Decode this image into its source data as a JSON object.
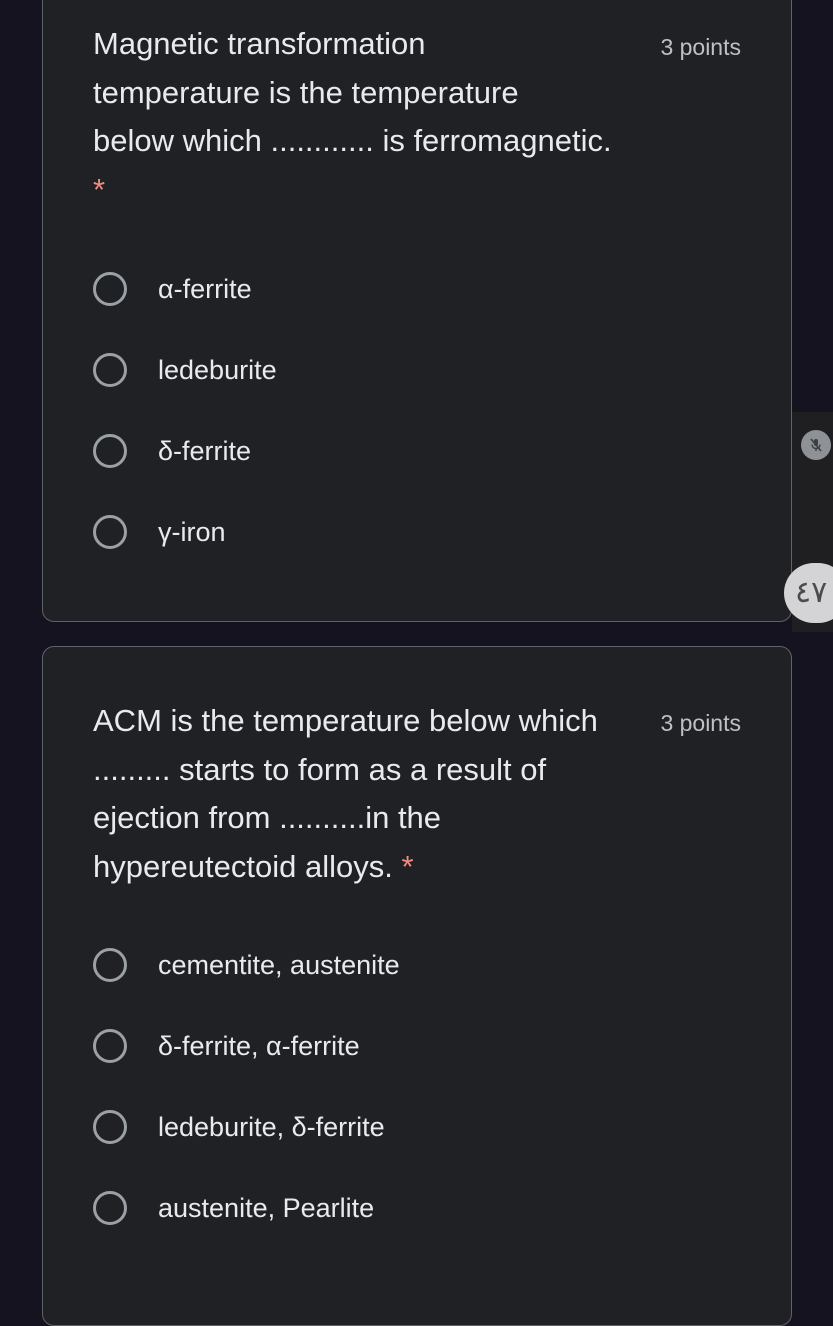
{
  "questions": [
    {
      "text_lines": [
        "Magnetic transformation",
        "temperature is the temperature",
        "below which ............ is ferromagnetic."
      ],
      "required_marker": "*",
      "points": "3 points",
      "options": [
        "α-ferrite",
        "ledeburite",
        "δ-ferrite",
        "γ-iron"
      ]
    },
    {
      "text_lines": [
        "ACM is the temperature below which",
        "......... starts to form as a result of",
        "ejection from ..........in the",
        "hypereutectoid alloys."
      ],
      "required_marker": "*",
      "points": "3 points",
      "options": [
        "cementite, austenite",
        "δ-ferrite, α-ferrite",
        "ledeburite, δ-ferrite",
        "austenite, Pearlite"
      ]
    }
  ],
  "overlay": {
    "mic_icon": "mic-off-icon",
    "counter_text": "٤٧"
  }
}
